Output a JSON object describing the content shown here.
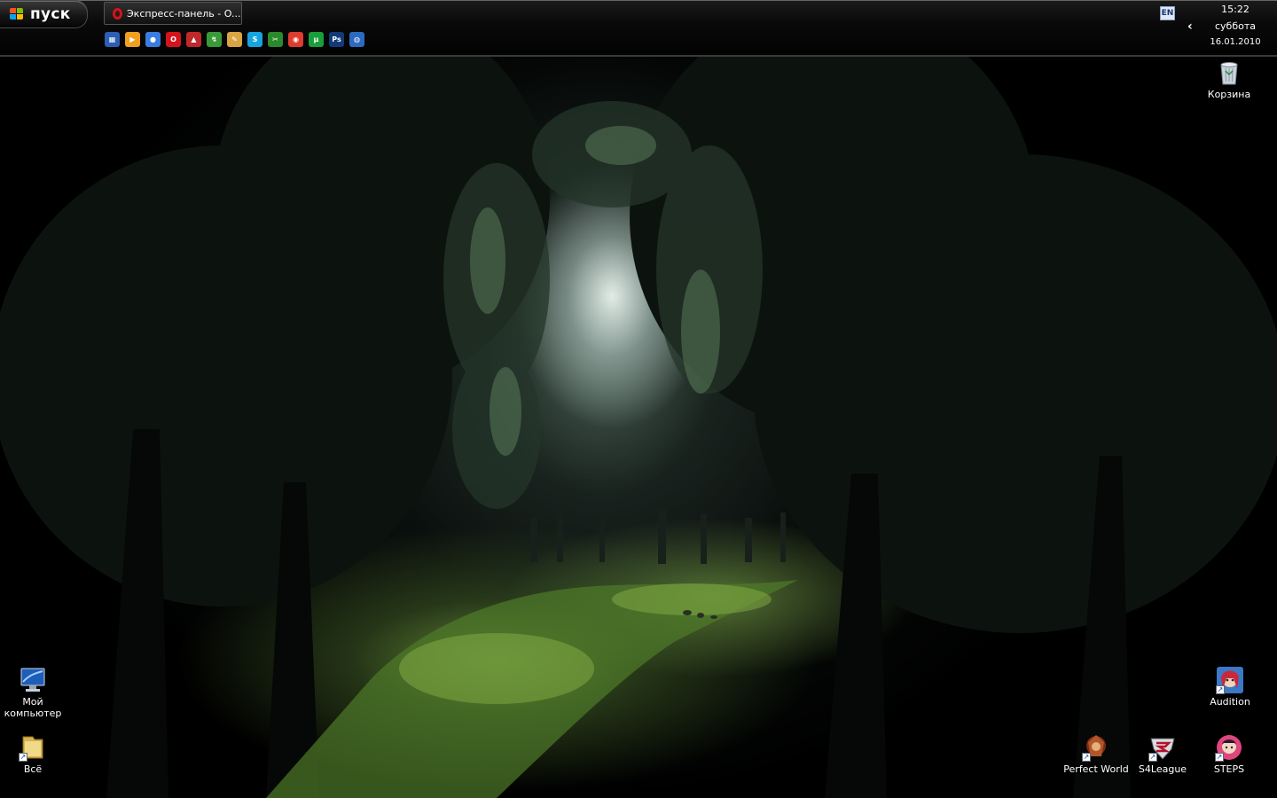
{
  "taskbar": {
    "start_label": "пуск",
    "task_button_label": "Экспресс-панель - O...",
    "language": "EN",
    "clock_time": "15:22",
    "clock_day": "суббота",
    "clock_date": "16.01.2010",
    "quicklaunch": [
      {
        "name": "desktop-icon",
        "color": "#2c5fb3",
        "glyph": "▦"
      },
      {
        "name": "media-player-icon",
        "color": "#f0a020",
        "glyph": "▶"
      },
      {
        "name": "sport-ball-icon",
        "color": "#3a7de0",
        "glyph": "●"
      },
      {
        "name": "opera-icon",
        "color": "#d4131b",
        "glyph": "O"
      },
      {
        "name": "red-app-icon",
        "color": "#c0282a",
        "glyph": "▲"
      },
      {
        "name": "green-app-icon",
        "color": "#3a9a3a",
        "glyph": "↯"
      },
      {
        "name": "pencil-icon",
        "color": "#d9a441",
        "glyph": "✎"
      },
      {
        "name": "skype-icon",
        "color": "#16a4e0",
        "glyph": "S"
      },
      {
        "name": "mp3cut-icon",
        "color": "#2b8a2b",
        "glyph": "✂"
      },
      {
        "name": "chrome-icon",
        "color": "#dd3c2f",
        "glyph": "◉"
      },
      {
        "name": "utorrent-icon",
        "color": "#1a9e3a",
        "glyph": "µ"
      },
      {
        "name": "photoshop-icon",
        "color": "#123a78",
        "glyph": "Ps"
      },
      {
        "name": "globe-icon",
        "color": "#2c6ac2",
        "glyph": "◍"
      }
    ]
  },
  "desktop": {
    "icons": [
      {
        "key": "recycle",
        "label": "Корзина"
      },
      {
        "key": "mycomputer",
        "label": "Мой компьютер"
      },
      {
        "key": "all",
        "label": "Всё"
      },
      {
        "key": "audition",
        "label": "Audition"
      },
      {
        "key": "perfectworld",
        "label": "Perfect World"
      },
      {
        "key": "s4league",
        "label": "S4League"
      },
      {
        "key": "steps",
        "label": "STEPS"
      }
    ]
  },
  "colors": {
    "taskbar_bg": "#0a0a0a",
    "accent_green": "#6f9a3a",
    "opera_red": "#d4131b"
  }
}
